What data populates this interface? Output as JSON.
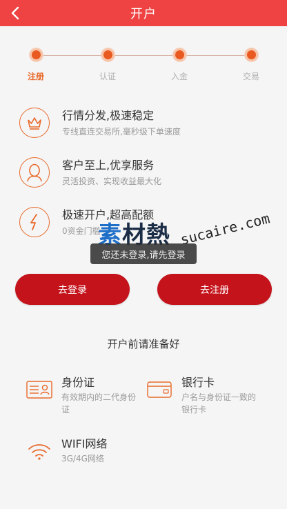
{
  "header": {
    "title": "开户"
  },
  "steps": [
    {
      "label": "注册",
      "active": true
    },
    {
      "label": "认证",
      "active": false
    },
    {
      "label": "入金",
      "active": false
    },
    {
      "label": "交易",
      "active": false
    }
  ],
  "features": [
    {
      "icon": "crown-icon",
      "title": "行情分发,极速稳定",
      "subtitle": "专线直连交易所,毫秒级下单速度"
    },
    {
      "icon": "user-icon",
      "title": "客户至上,优享服务",
      "subtitle": "灵活投资、实现收益最大化"
    },
    {
      "icon": "lightning-icon",
      "title": "极速开户,超高配额",
      "subtitle": "0资金门槛"
    }
  ],
  "toast": {
    "text": "您还未登录,请先登录"
  },
  "watermark": {
    "cn_a": "素",
    "cn_b": "材熱",
    "en": "sucaire.com"
  },
  "buttons": {
    "login": "去登录",
    "register": "去注册"
  },
  "prepare": {
    "title": "开户前请准备好",
    "items": [
      {
        "icon": "id-card-icon",
        "title": "身份证",
        "subtitle": "有效期内的二代身份证"
      },
      {
        "icon": "bank-card-icon",
        "title": "银行卡",
        "subtitle": "户名与身份证一致的银行卡"
      },
      {
        "icon": "wifi-icon",
        "title": "WIFI网络",
        "subtitle": "3G/4G网络"
      }
    ]
  },
  "colors": {
    "header_bg": "#ef4343",
    "accent": "#e8692a",
    "button_bg": "#c4131b"
  }
}
